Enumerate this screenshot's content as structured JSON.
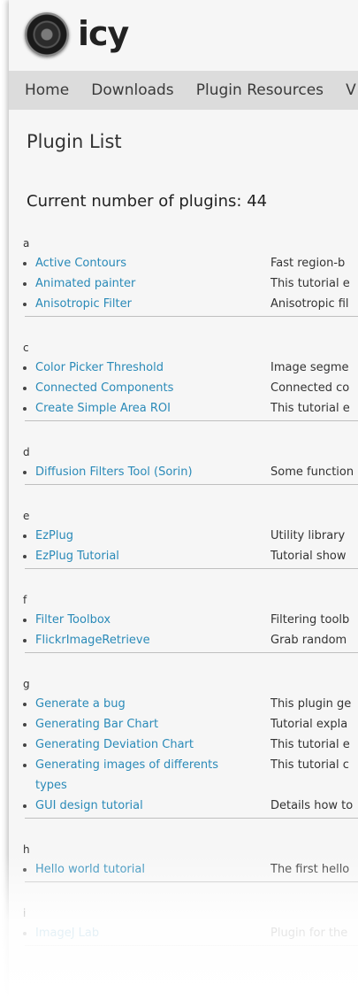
{
  "site": {
    "logo_text": "icy"
  },
  "nav": {
    "items": [
      "Home",
      "Downloads",
      "Plugin Resources",
      "V"
    ]
  },
  "page": {
    "title": "Plugin List",
    "count_label": "Current number of plugins: 44"
  },
  "groups": [
    {
      "letter": "a",
      "items": [
        {
          "name": "Active Contours",
          "desc": "Fast region-b"
        },
        {
          "name": "Animated painter",
          "desc": "This tutorial e"
        },
        {
          "name": "Anisotropic Filter",
          "desc": "Anisotropic fil"
        }
      ]
    },
    {
      "letter": "c",
      "items": [
        {
          "name": "Color Picker Threshold",
          "desc": "Image segme"
        },
        {
          "name": "Connected Components",
          "desc": "Connected co"
        },
        {
          "name": "Create Simple Area ROI",
          "desc": "This tutorial e"
        }
      ]
    },
    {
      "letter": "d",
      "items": [
        {
          "name": "Diffusion Filters Tool (Sorin)",
          "desc": "Some function"
        }
      ]
    },
    {
      "letter": "e",
      "items": [
        {
          "name": "EzPlug",
          "desc": "Utility library"
        },
        {
          "name": "EzPlug Tutorial",
          "desc": "Tutorial show"
        }
      ]
    },
    {
      "letter": "f",
      "items": [
        {
          "name": "Filter Toolbox",
          "desc": "Filtering toolb"
        },
        {
          "name": "FlickrImageRetrieve",
          "desc": "Grab random"
        }
      ]
    },
    {
      "letter": "g",
      "items": [
        {
          "name": "Generate a bug",
          "desc": "This plugin ge"
        },
        {
          "name": "Generating Bar Chart",
          "desc": "Tutorial expla"
        },
        {
          "name": "Generating Deviation Chart",
          "desc": "This tutorial e"
        },
        {
          "name": "Generating images of differents types",
          "desc": "This tutorial c"
        },
        {
          "name": "GUI design tutorial",
          "desc": "Details how to"
        }
      ]
    },
    {
      "letter": "h",
      "items": [
        {
          "name": "Hello world tutorial",
          "desc": "The first hello"
        }
      ]
    },
    {
      "letter": "i",
      "items": [
        {
          "name": "ImageJ Lab",
          "desc": "Plugin for the"
        }
      ]
    }
  ]
}
